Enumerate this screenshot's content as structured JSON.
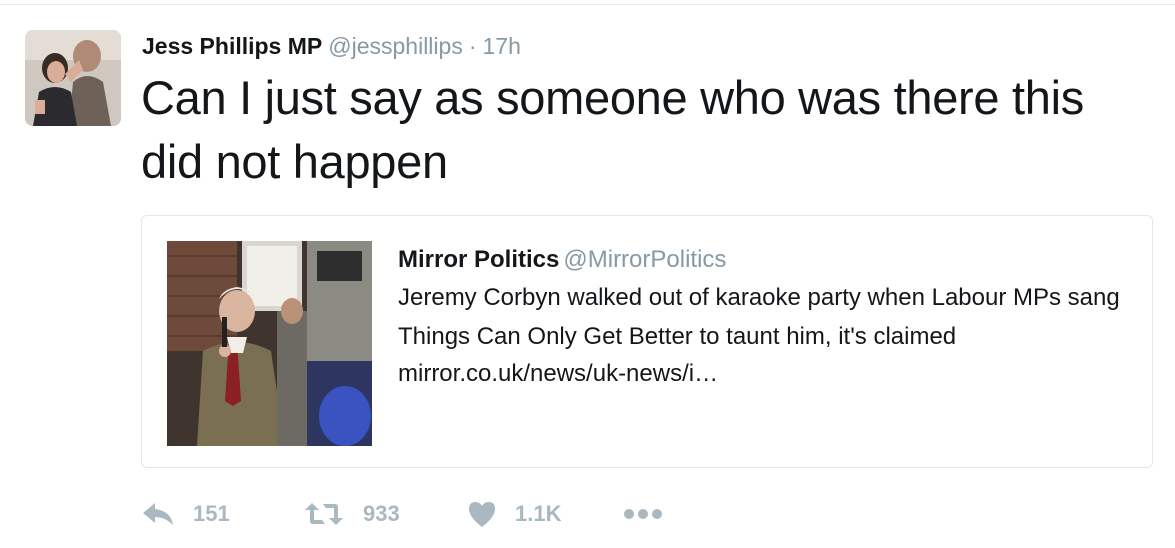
{
  "tweet": {
    "author_name": "Jess Phillips MP",
    "author_handle": "@jessphillips",
    "separator": "·",
    "timestamp": "17h",
    "text": "Can I just say as someone who was there this did not happen"
  },
  "quoted_tweet": {
    "author_name": "Mirror Politics",
    "author_handle": "@MirrorPolitics",
    "text": "Jeremy Corbyn walked out of karaoke party when Labour MPs sang Things Can Only Get Better to taunt him, it's claimed",
    "link": "mirror.co.uk/news/uk-news/i…"
  },
  "actions": {
    "reply_count": "151",
    "retweet_count": "933",
    "like_count": "1.1K",
    "icons": [
      "reply-icon",
      "retweet-icon",
      "heart-icon",
      "more-icon"
    ]
  },
  "colors": {
    "muted": "#8899a6",
    "action_icon": "#aab8c2",
    "border": "#e1e8ed",
    "text": "#14171a"
  }
}
